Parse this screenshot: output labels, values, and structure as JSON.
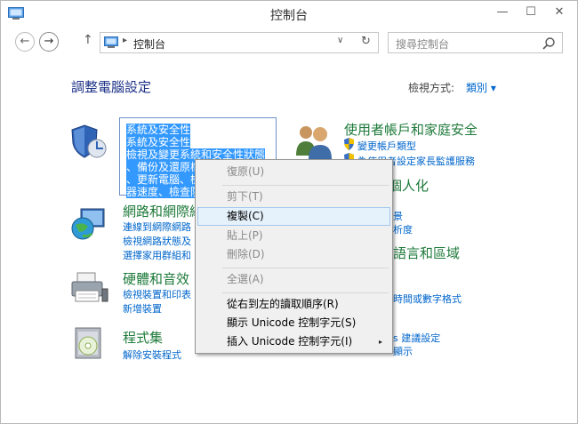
{
  "window": {
    "title": "控制台",
    "min_glyph": "—",
    "max_glyph": "☐",
    "close_glyph": "✕"
  },
  "nav": {
    "back_glyph": "←",
    "forward_glyph": "→",
    "up_glyph": "↑",
    "address_separator": "▸",
    "address_text": "控制台",
    "dropdown_glyph": "∨",
    "refresh_glyph": "↻",
    "search_placeholder": "搜尋控制台"
  },
  "main": {
    "heading": "調整電腦設定",
    "view_by_label": "檢視方式:",
    "view_by_value": "類別 ▾"
  },
  "categories_left": [
    {
      "title": "系統及安全性",
      "icon": "security-shield-icon",
      "links": []
    },
    {
      "title": "網路和網際網",
      "icon": "network-globe-icon",
      "links": [
        "連線到網際網路",
        "檢視網路狀態及",
        "選擇家用群組和"
      ]
    },
    {
      "title": "硬體和音效",
      "icon": "printer-icon",
      "links": [
        "檢視裝置和印表",
        "新增裝置"
      ]
    },
    {
      "title": "程式集",
      "icon": "programs-disc-icon",
      "links": [
        "解除安裝程式"
      ]
    }
  ],
  "categories_right": [
    {
      "title": "使用者帳戶和家庭安全",
      "icon": "users-icon",
      "links": [
        "變更帳戶類型",
        "為使用者設定家長監護服務"
      ]
    },
    {
      "title": "個人化",
      "links": [
        "景",
        "析度"
      ]
    },
    {
      "title": "語言和區域",
      "links": [
        "時間或數字格式"
      ]
    },
    {
      "title": "",
      "links": [
        "s 建議設定",
        "顯示"
      ]
    }
  ],
  "rename_box": {
    "lines": [
      "系統及安全性",
      "系統及安全性",
      "檢視及變更系統和安全性狀態",
      "、備份及還原檔",
      "、更新電腦、檢",
      "器速度、檢查防"
    ]
  },
  "context_menu": {
    "items": [
      {
        "label": "復原(U)",
        "enabled": false
      },
      {
        "label": "剪下(T)",
        "enabled": false
      },
      {
        "label": "複製(C)",
        "enabled": true,
        "highlighted": true
      },
      {
        "label": "貼上(P)",
        "enabled": false
      },
      {
        "label": "刪除(D)",
        "enabled": false
      },
      {
        "label": "全選(A)",
        "enabled": false
      },
      {
        "label": "從右到左的讀取順序(R)",
        "enabled": true
      },
      {
        "label": "顯示 Unicode 控制字元(S)",
        "enabled": true
      },
      {
        "label": "插入 Unicode 控制字元(I)",
        "enabled": true,
        "submenu": true
      }
    ],
    "submenu_glyph": "▸"
  },
  "colors": {
    "heading": "#1e3287",
    "category_title": "#1e7a3a",
    "link": "#0066cc",
    "selection": "#3399ff",
    "menu_hover": "#e5f1fb"
  }
}
